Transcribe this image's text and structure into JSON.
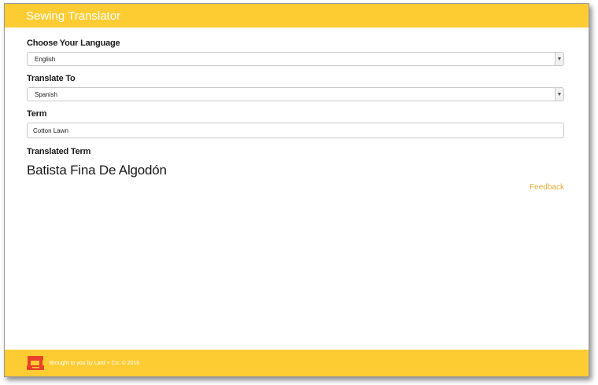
{
  "app": {
    "title": "Sewing Translator"
  },
  "form": {
    "source_language": {
      "label": "Choose Your Language",
      "value": "English"
    },
    "target_language": {
      "label": "Translate To",
      "value": "Spanish"
    },
    "term": {
      "label": "Term",
      "value": "Cotton Lawn"
    },
    "translated": {
      "label": "Translated Term",
      "value": "Batista Fina De Algodón"
    }
  },
  "links": {
    "feedback": "Feedback"
  },
  "footer": {
    "credit": "Brought to you by Lard + Co. © 2016"
  },
  "colors": {
    "brand": "#fdcc33",
    "link": "#e2a93a",
    "logo": "#e8412a"
  },
  "icons": {
    "logo": "sewing-machine-icon",
    "select_arrow": "chevron-down-icon"
  }
}
